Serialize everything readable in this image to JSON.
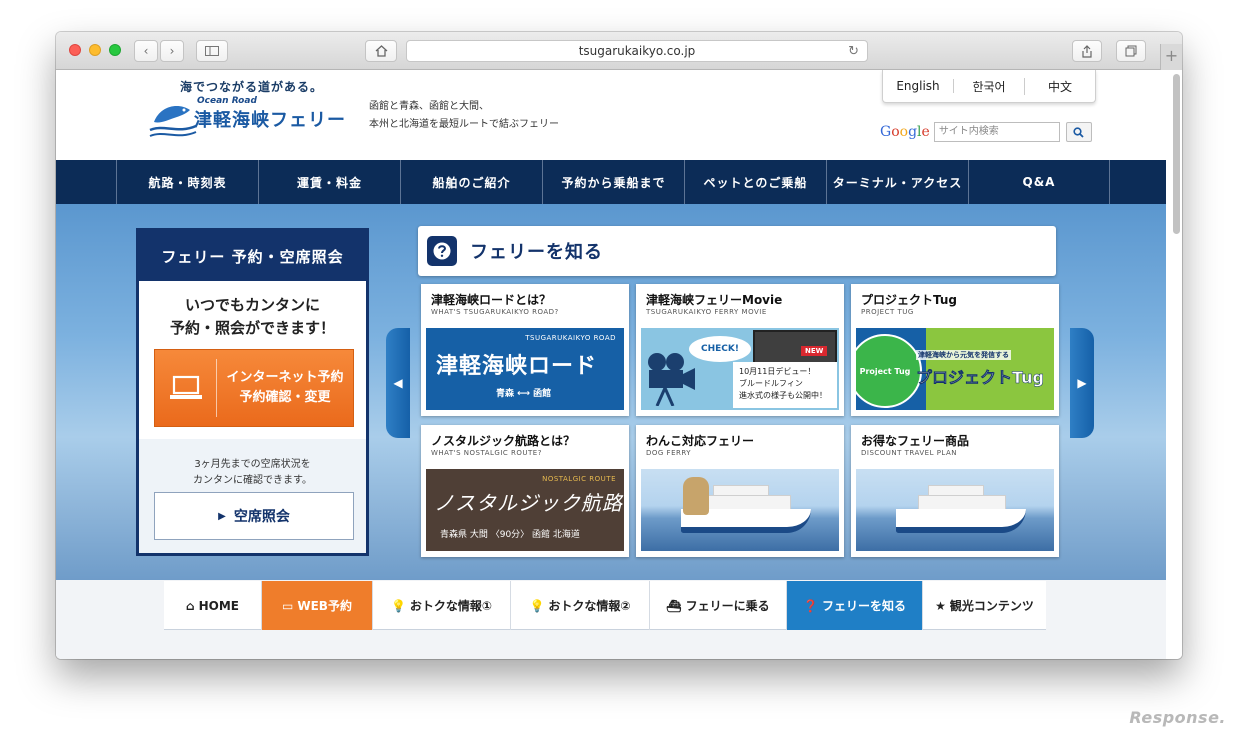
{
  "browser": {
    "url": "tsugarukaikyo.co.jp"
  },
  "header": {
    "tagline": "海でつながる道がある。",
    "ocean_road": "Ocean Road",
    "brand": "津軽海峡フェリー",
    "description_line1": "函館と青森、函館と大間、",
    "description_line2": "本州と北海道を最短ルートで結ぶフェリー",
    "languages": [
      "English",
      "한국어",
      "中文"
    ],
    "search_placeholder": "サイト内検索"
  },
  "nav": {
    "items": [
      "航路・時刻表",
      "運賃・料金",
      "船舶のご紹介",
      "予約から乗船まで",
      "ペットとのご乗船",
      "ターミナル・アクセス",
      "Q&A"
    ]
  },
  "reserve": {
    "title": "フェリー 予約・空席照会",
    "msg_line1": "いつでもカンタンに",
    "msg_line2": "予約・照会ができます！",
    "internet_line1": "インターネット予約",
    "internet_line2": "予約確認・変更",
    "note_line1": "3ヶ月先までの空席状況を",
    "note_line2": "カンタンに確認できます。",
    "seat_button": "空席照会"
  },
  "know": {
    "title": "フェリーを知る"
  },
  "cards": [
    {
      "title": "津軽海峡ロードとは？",
      "subtitle": "WHAT'S TSUGARUKAIKYO ROAD?",
      "img_small": "TSUGARUKAIKYO ROAD",
      "img_big": "津軽海峡ロード",
      "img_route": "青森 ⟷ 函館"
    },
    {
      "title": "津軽海峡フェリーMovie",
      "subtitle": "TSUGARUKAIKYO FERRY MOVIE",
      "img_check": "CHECK!",
      "img_new": "NEW",
      "img_note_line1": "10月11日デビュー！",
      "img_note_line2": "ブルードルフィン",
      "img_note_line3": "進水式の様子も公開中！"
    },
    {
      "title": "プロジェクトTug",
      "subtitle": "PROJECT TUG",
      "img_globe": "Project Tug",
      "img_sub": "津軽海峡から元気を発信する",
      "img_big": "プロジェクトTug"
    },
    {
      "title": "ノスタルジック航路とは？",
      "subtitle": "WHAT'S NOSTALGIC ROUTE?",
      "img_small": "NOSTALGIC ROUTE",
      "img_big": "ノスタルジック航路",
      "img_route": "青森県 大間 〈90分〉 函館 北海道"
    },
    {
      "title": "わんこ対応フェリー",
      "subtitle": "DOG FERRY"
    },
    {
      "title": "お得なフェリー商品",
      "subtitle": "DISCOUNT TRAVEL PLAN"
    }
  ],
  "subnav": {
    "items": [
      {
        "icon": "home-icon",
        "label": "HOME"
      },
      {
        "icon": "pc-icon",
        "label": "WEB予約"
      },
      {
        "icon": "bulb-icon",
        "label": "おトクな情報①"
      },
      {
        "icon": "bulb-icon",
        "label": "おトクな情報②"
      },
      {
        "icon": "ship-icon",
        "label": "フェリーに乗る"
      },
      {
        "icon": "question-icon",
        "label": "フェリーを知る"
      },
      {
        "icon": "star-icon",
        "label": "観光コンテンツ"
      }
    ]
  },
  "watermark": "Response.",
  "colors": {
    "navy": "#0c2c57",
    "orange": "#ef7d2b",
    "blue_active": "#1f7fc6"
  }
}
